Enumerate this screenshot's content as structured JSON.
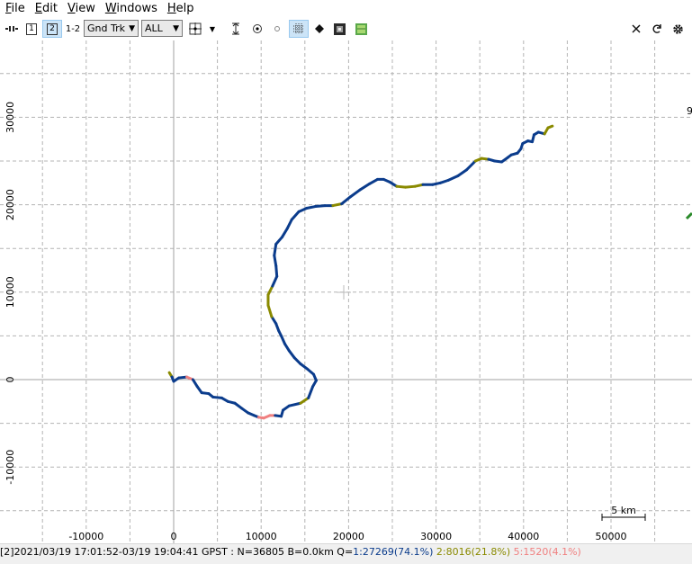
{
  "menu": {
    "items": [
      {
        "label": "File",
        "underline": "F",
        "rest": "ile"
      },
      {
        "label": "Edit",
        "underline": "E",
        "rest": "dit"
      },
      {
        "label": "View",
        "underline": "V",
        "rest": "iew"
      },
      {
        "label": "Windows",
        "underline": "W",
        "rest": "indows"
      },
      {
        "label": "Help",
        "underline": "H",
        "rest": "elp"
      }
    ]
  },
  "toolbar": {
    "btn1_label": "1",
    "btn2_label": "2",
    "btn12_label": "1-2",
    "plot_type": "Gnd Trk",
    "sat_filter": "ALL",
    "selected": "2"
  },
  "plot": {
    "x_ticks": [
      "-10000",
      "0",
      "10000",
      "20000",
      "30000",
      "40000",
      "50000"
    ],
    "y_ticks": [
      "30000",
      "20000",
      "10000",
      "0",
      "-10000"
    ],
    "scale_label": "5 km",
    "right_edge_label": "9",
    "colors": {
      "q1": "#0b3c8c",
      "q2": "#8a8a00",
      "q5": "#f08080",
      "grid": "#b4b4b4",
      "axis": "#a0a0a0"
    }
  },
  "chart_data": {
    "type": "line",
    "title": "",
    "xlabel": "",
    "ylabel": "",
    "xlim": [
      -19500,
      59000
    ],
    "ylim": [
      -18000,
      39000
    ],
    "grid": true,
    "series": [
      {
        "points": [
          [
            -500,
            800
          ],
          [
            -200,
            300
          ],
          [
            0,
            -200
          ],
          [
            600,
            200
          ],
          [
            1500,
            300
          ],
          [
            2200,
            0
          ],
          [
            2700,
            -800
          ],
          [
            3200,
            -1500
          ],
          [
            4000,
            -1600
          ],
          [
            4500,
            -2000
          ],
          [
            5500,
            -2100
          ],
          [
            6200,
            -2500
          ],
          [
            7000,
            -2700
          ],
          [
            7800,
            -3300
          ],
          [
            8500,
            -3800
          ],
          [
            9200,
            -4100
          ],
          [
            9700,
            -4300
          ],
          [
            10300,
            -4400
          ],
          [
            11000,
            -4100
          ],
          [
            11600,
            -4100
          ],
          [
            12300,
            -4200
          ],
          [
            12500,
            -3500
          ],
          [
            13200,
            -3000
          ],
          [
            14500,
            -2700
          ],
          [
            15400,
            -2100
          ],
          [
            15900,
            -800
          ],
          [
            16300,
            -100
          ],
          [
            16000,
            600
          ],
          [
            15300,
            1200
          ],
          [
            14500,
            1800
          ],
          [
            13800,
            2500
          ],
          [
            13200,
            3300
          ],
          [
            12700,
            4100
          ],
          [
            12300,
            5000
          ],
          [
            12000,
            5600
          ],
          [
            11700,
            6400
          ],
          [
            11200,
            7200
          ],
          [
            10800,
            8500
          ],
          [
            10800,
            9700
          ],
          [
            11300,
            10700
          ],
          [
            11800,
            11800
          ],
          [
            11700,
            13000
          ],
          [
            11500,
            14200
          ],
          [
            11700,
            15500
          ],
          [
            12400,
            16300
          ],
          [
            13000,
            17300
          ],
          [
            13500,
            18300
          ],
          [
            14300,
            19200
          ],
          [
            15200,
            19600
          ],
          [
            16200,
            19800
          ],
          [
            17300,
            19900
          ],
          [
            18200,
            19900
          ],
          [
            19200,
            20100
          ],
          [
            20200,
            20900
          ],
          [
            21300,
            21700
          ],
          [
            22400,
            22400
          ],
          [
            23300,
            22900
          ],
          [
            24000,
            22900
          ],
          [
            24700,
            22600
          ],
          [
            25500,
            22100
          ],
          [
            26500,
            22000
          ],
          [
            27600,
            22100
          ],
          [
            28500,
            22300
          ],
          [
            29600,
            22300
          ],
          [
            30500,
            22500
          ],
          [
            31400,
            22800
          ],
          [
            32500,
            23300
          ],
          [
            33500,
            24000
          ],
          [
            34500,
            25000
          ],
          [
            35200,
            25300
          ],
          [
            36000,
            25200
          ],
          [
            36700,
            25000
          ],
          [
            37500,
            24900
          ],
          [
            38200,
            25400
          ],
          [
            38600,
            25700
          ],
          [
            39300,
            25900
          ],
          [
            39700,
            26400
          ],
          [
            39900,
            27000
          ],
          [
            40500,
            27300
          ],
          [
            41000,
            27200
          ],
          [
            41200,
            28000
          ],
          [
            41700,
            28300
          ],
          [
            42400,
            28100
          ],
          [
            42800,
            28800
          ],
          [
            43300,
            29000
          ]
        ],
        "quality": [
          2,
          2,
          1,
          1,
          1,
          5,
          1,
          1,
          1,
          1,
          1,
          1,
          1,
          1,
          1,
          1,
          1,
          5,
          5,
          5,
          1,
          1,
          1,
          1,
          2,
          1,
          1,
          1,
          1,
          1,
          1,
          1,
          1,
          1,
          1,
          1,
          1,
          2,
          2,
          2,
          1,
          1,
          1,
          1,
          1,
          1,
          1,
          1,
          1,
          1,
          1,
          1,
          2,
          1,
          1,
          1,
          1,
          1,
          1,
          1,
          2,
          2,
          2,
          1,
          1,
          1,
          1,
          1,
          1,
          2,
          2,
          1,
          1,
          1,
          1,
          1,
          1,
          1,
          1,
          1,
          1,
          1,
          1,
          2,
          2
        ]
      }
    ]
  },
  "status": {
    "prefix": "[2]2021/03/19 17:01:52-03/19 19:04:41 GPST : N=36805 B=0.0km Q=",
    "q1": "1:27269(74.1%)",
    "q2": "2:8016(21.8%)",
    "q5": "5:1520(4.1%)"
  }
}
